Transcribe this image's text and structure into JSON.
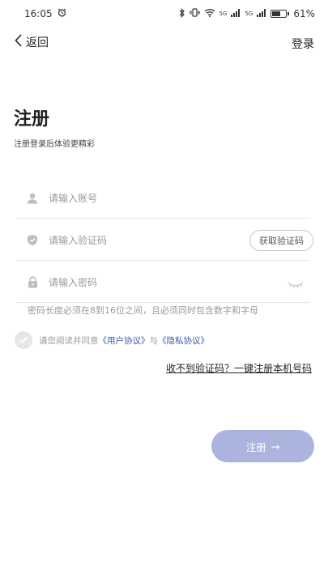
{
  "status": {
    "time": "16:05",
    "battery_pct": "61%",
    "battery_level": 0.61,
    "net1": "5G",
    "net2": "5G"
  },
  "nav": {
    "back_label": "返回",
    "login_label": "登录"
  },
  "header": {
    "title": "注册",
    "subtitle": "注册登录后体验更精彩"
  },
  "form": {
    "account_placeholder": "请输入账号",
    "code_placeholder": "请输入验证码",
    "get_code_label": "获取验证码",
    "password_placeholder": "请输入密码",
    "password_hint": "密码长度必须在8到16位之间，且必须同时包含数字和字母"
  },
  "agreement": {
    "prefix": "请您阅读并同意",
    "user_agreement": "《用户协议》",
    "joiner": "与",
    "privacy_agreement": "《隐私协议》"
  },
  "alt_register_label": "收不到验证码？一键注册本机号码",
  "register_button": {
    "label": "注册",
    "arrow": "→"
  },
  "colors": {
    "accent": "#aab4de",
    "link": "#3a5ba8"
  }
}
